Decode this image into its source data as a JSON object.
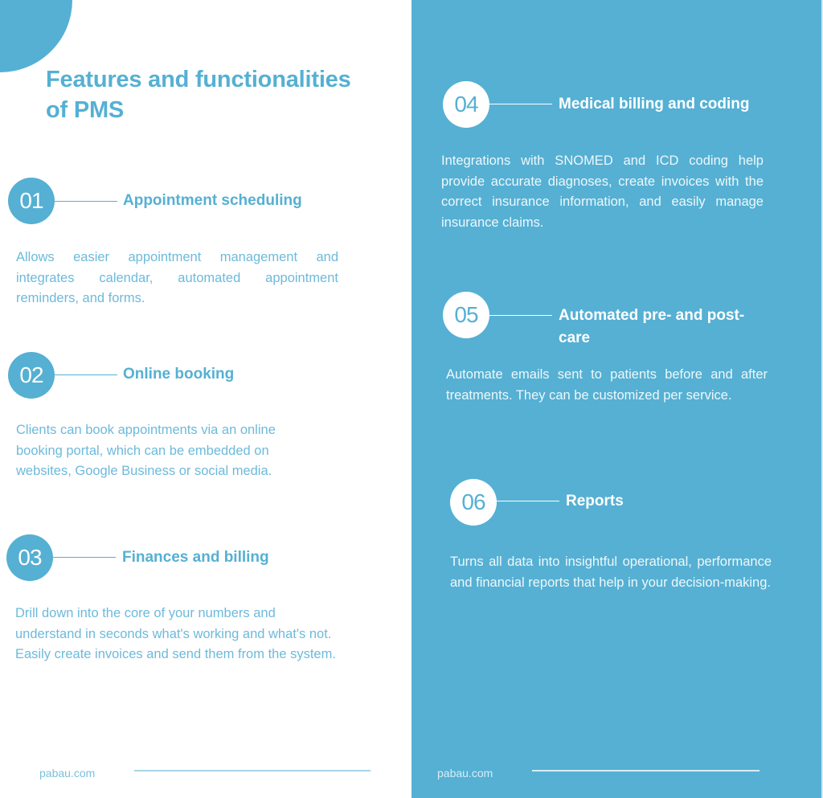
{
  "title": "Features and functionalities of PMS",
  "colors": {
    "accent": "#55b0d3",
    "background": "#ffffff",
    "text_on_accent": "#ffffff"
  },
  "features": [
    {
      "number": "01",
      "title": "Appointment scheduling",
      "description": "Allows easier appointment management and integrates calendar, automated appointment reminders, and forms."
    },
    {
      "number": "02",
      "title": "Online booking",
      "description": "Clients can book appointments via an online booking portal, which can be embedded on websites, Google Business or social media."
    },
    {
      "number": "03",
      "title": "Finances and billing",
      "description": "Drill down into the core of your numbers and understand in seconds what's working and what's not. Easily create invoices and send them from the system."
    },
    {
      "number": "04",
      "title": "Medical billing and coding",
      "description": "Integrations with SNOMED and ICD coding help provide accurate diagnoses, create invoices with the correct insurance information, and easily manage insurance claims."
    },
    {
      "number": "05",
      "title": "Automated pre- and post-care",
      "description": "Automate emails sent to patients before and after treatments. They can be customized per service."
    },
    {
      "number": "06",
      "title": "Reports",
      "description": "Turns all data into insightful operational, performance and financial reports that help in your decision-making."
    }
  ],
  "footer": {
    "left_link": "pabau.com",
    "right_link": "pabau.com"
  }
}
